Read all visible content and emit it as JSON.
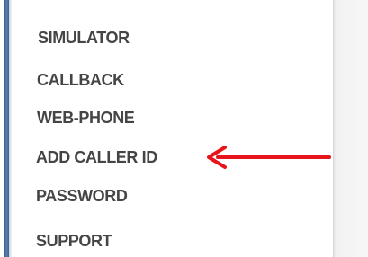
{
  "menu": {
    "items": [
      {
        "label": "SIMULATOR"
      },
      {
        "label": "CALLBACK"
      },
      {
        "label": "WEB-PHONE"
      },
      {
        "label": "ADD CALLER ID"
      },
      {
        "label": "PASSWORD"
      },
      {
        "label": "SUPPORT"
      }
    ]
  },
  "annotation": {
    "arrow_color": "#e8141b",
    "arrow_icon": "left-arrow-icon",
    "points_to": "ADD CALLER ID"
  },
  "colors": {
    "menu_text": "#454545",
    "left_bar": "#4a6a9a"
  }
}
